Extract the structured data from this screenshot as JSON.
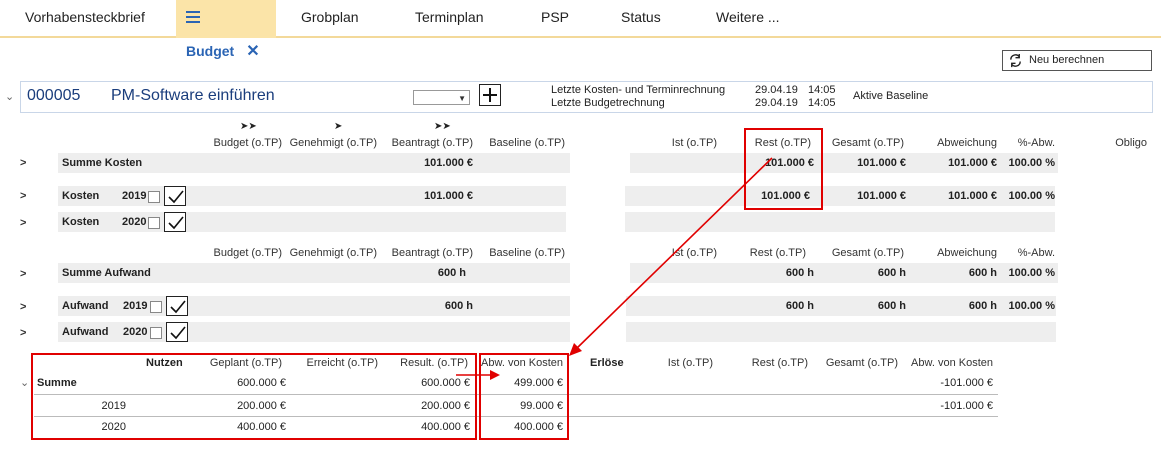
{
  "tabs": [
    {
      "label": "Vorhabensteckbrief"
    },
    {
      "label": "Budget"
    },
    {
      "label": "Grobplan"
    },
    {
      "label": "Terminplan"
    },
    {
      "label": "PSP"
    },
    {
      "label": "Status"
    },
    {
      "label": "Weitere ..."
    }
  ],
  "toolbar": {
    "recalc_label": "Neu berechnen"
  },
  "project": {
    "id": "000005",
    "title": "PM-Software einführen",
    "last_cost_label": "Letzte Kosten- und Terminrechnung",
    "last_cost_date": "29.04.19",
    "last_cost_time": "14:05",
    "last_budget_label": "Letzte Budgetrechnung",
    "last_budget_date": "29.04.19",
    "last_budget_time": "14:05",
    "baseline_label": "Aktive Baseline"
  },
  "kosten": {
    "headers": [
      "Budget (o.TP)",
      "Genehmigt (o.TP)",
      "Beantragt (o.TP)",
      "Baseline (o.TP)",
      "Ist (o.TP)",
      "Rest (o.TP)",
      "Gesamt (o.TP)",
      "Abweichung",
      "%-Abw.",
      "Obligo"
    ],
    "summe_label": "Summe Kosten",
    "summe": {
      "beantragt": "101.000 €",
      "rest": "101.000 €",
      "gesamt": "101.000 €",
      "abweichung": "101.000 €",
      "pct": "100.00 %"
    },
    "row_label": "Kosten",
    "rows": [
      {
        "year": "2019",
        "beantragt": "101.000 €",
        "rest": "101.000 €",
        "gesamt": "101.000 €",
        "abweichung": "101.000 €",
        "pct": "100.00 %"
      },
      {
        "year": "2020"
      }
    ]
  },
  "aufwand": {
    "headers": [
      "Budget (o.TP)",
      "Genehmigt (o.TP)",
      "Beantragt (o.TP)",
      "Baseline (o.TP)",
      "Ist (o.TP)",
      "Rest (o.TP)",
      "Gesamt (o.TP)",
      "Abweichung",
      "%-Abw."
    ],
    "summe_label": "Summe Aufwand",
    "summe": {
      "beantragt": "600 h",
      "rest": "600 h",
      "gesamt": "600 h",
      "abweichung": "600 h",
      "pct": "100.00 %"
    },
    "row_label": "Aufwand",
    "rows": [
      {
        "year": "2019",
        "beantragt": "600 h",
        "rest": "600 h",
        "gesamt": "600 h",
        "abweichung": "600 h",
        "pct": "100.00 %"
      },
      {
        "year": "2020"
      }
    ]
  },
  "nutzen": {
    "title": "Nutzen",
    "headers": [
      "Geplant (o.TP)",
      "Erreicht (o.TP)",
      "Result. (o.TP)",
      "Abw. von Kosten"
    ],
    "erloese_title": "Erlöse",
    "erloese_headers": [
      "Ist (o.TP)",
      "Rest (o.TP)",
      "Gesamt (o.TP)",
      "Abw. von Kosten"
    ],
    "summe_label": "Summe",
    "summe": {
      "geplant": "600.000 €",
      "result": "600.000 €",
      "abw": "499.000 €",
      "erl_abw": "-101.000 €"
    },
    "rows": [
      {
        "year": "2019",
        "geplant": "200.000 €",
        "result": "200.000 €",
        "abw": "99.000 €",
        "erl_abw": "-101.000 €"
      },
      {
        "year": "2020",
        "geplant": "400.000 €",
        "result": "400.000 €",
        "abw": "400.000 €"
      }
    ]
  },
  "colors": {
    "accent": "#2a64b4",
    "tab_active": "#fbe4a8",
    "highlight": "#e00000"
  }
}
